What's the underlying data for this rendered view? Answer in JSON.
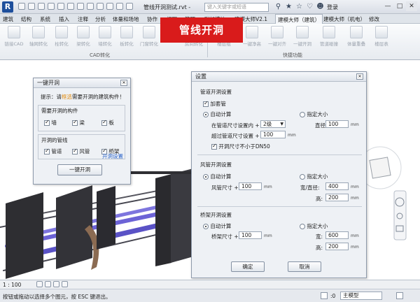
{
  "app": {
    "logo": "R",
    "doc_title": "管线开洞测试.rvt -",
    "search_placeholder": "键入关键字或短语",
    "login": "登录"
  },
  "ribbon_tabs": [
    "建筑",
    "结构",
    "系统",
    "插入",
    "注释",
    "分析",
    "体量和场地",
    "协作",
    "视图",
    "管理",
    "附加模块",
    "建模大师V2.1",
    "建模大师（建筑）",
    "建模大师（机电）",
    "修改"
  ],
  "active_tab_index": 12,
  "ribbon_buttons": [
    "链接CAD",
    "轴网转化",
    "柱转化",
    "梁转化",
    "墙转化",
    "板转化",
    "门窗转化",
    "房间转化",
    "楼层组",
    "一键净高",
    "一键对齐",
    "一键开洞",
    "管道碰撞",
    "体量重叠",
    "楼层表"
  ],
  "ribbon_groups": {
    "cad": "CAD转化",
    "quick": "快捷功能"
  },
  "banner": "管线开洞",
  "yijian": {
    "title": "一键开洞",
    "hint_prefix": "提示：请",
    "hint_highlight": "框选",
    "hint_suffix": "需要开洞的建筑构件！",
    "group1": "需要开洞的构件",
    "items1": [
      {
        "label": "墙",
        "checked": true
      },
      {
        "label": "梁",
        "checked": true
      },
      {
        "label": "板",
        "checked": true
      }
    ],
    "group2": "开洞的管线",
    "items2": [
      {
        "label": "管道",
        "checked": true
      },
      {
        "label": "风管",
        "checked": true
      },
      {
        "label": "桥架",
        "checked": true
      }
    ],
    "settings_link": "开洞设置",
    "run_button": "一键开洞"
  },
  "settings": {
    "title": "设置",
    "pipe": {
      "section": "管道开洞设置",
      "sleeve_label": "加套管",
      "sleeve_checked": true,
      "auto_label": "自动计算",
      "fixed_label": "指定大小",
      "pipe_size_label": "在管道尺寸设置内 +",
      "pipe_size_value": "2级",
      "exceed_label": "超过管道尺寸设置 +",
      "exceed_value": "100",
      "min_label": "开洞尺寸不小于DN50",
      "min_checked": true,
      "diameter_label": "直径:",
      "diameter_value": "100"
    },
    "duct": {
      "section": "风管开洞设置",
      "auto_label": "自动计算",
      "fixed_label": "指定大小",
      "size_label": "风管尺寸 +",
      "size_value": "100",
      "wd_label": "宽/直径:",
      "wd_value": "400",
      "h_label": "高:",
      "h_value": "200"
    },
    "tray": {
      "section": "桥架开洞设置",
      "auto_label": "自动计算",
      "fixed_label": "指定大小",
      "size_label": "桥架尺寸 +",
      "size_value": "100",
      "w_label": "宽:",
      "w_value": "600",
      "h_label": "高:",
      "h_value": "200"
    },
    "unit": "mm",
    "ok": "确定",
    "cancel": "取消"
  },
  "status": {
    "scale": "1 : 100",
    "hint": "按钮或拖动以选择多个图元，按 ESC 键退出。",
    "model": "主模型",
    "zero": ":0"
  },
  "icons": [
    "app-logo",
    "search-icon",
    "binoculars-icon",
    "star-icon",
    "help-icon",
    "close-icon",
    "viewcube-icon",
    "navigation-wheel-icon"
  ]
}
